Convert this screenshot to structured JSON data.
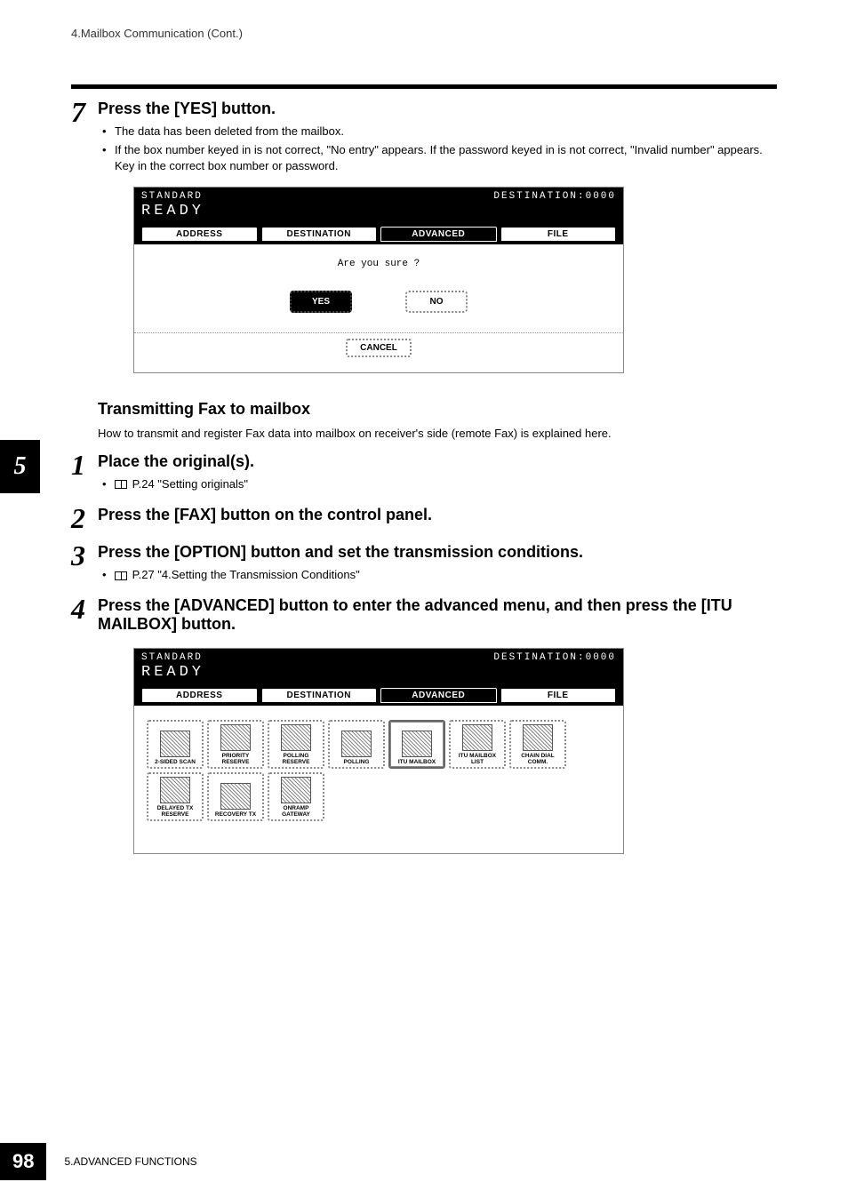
{
  "header": "4.Mailbox Communication (Cont.)",
  "chapter_tab": "5",
  "step7": {
    "num": "7",
    "title": "Press the [YES] button.",
    "bullets": [
      "The data has been deleted from the mailbox.",
      "If the box number keyed in is not correct, \"No entry\" appears. If the password keyed in is not correct, \"Invalid number\" appears. Key in the correct box number or password."
    ]
  },
  "screenshot1": {
    "top_left": "STANDARD",
    "ready": "READY",
    "top_right": "DESTINATION:0000",
    "tabs": [
      "ADDRESS",
      "DESTINATION",
      "ADVANCED",
      "FILE"
    ],
    "active_tab_index": 2,
    "prompt": "Are you sure ?",
    "yes": "YES",
    "no": "NO",
    "cancel": "CANCEL"
  },
  "section": {
    "heading": "Transmitting Fax to mailbox",
    "intro": "How to transmit and register Fax data into mailbox on receiver's side (remote Fax) is explained here."
  },
  "step1": {
    "num": "1",
    "title": "Place the original(s).",
    "ref": "P.24 \"Setting originals\""
  },
  "step2": {
    "num": "2",
    "title": "Press the [FAX] button on the control panel."
  },
  "step3": {
    "num": "3",
    "title": "Press the [OPTION] button and set the transmission conditions.",
    "ref": "P.27 \"4.Setting the Transmission Conditions\""
  },
  "step4": {
    "num": "4",
    "title": "Press the [ADVANCED] button to enter the advanced menu, and then press the [ITU MAILBOX] button."
  },
  "screenshot2": {
    "top_left": "STANDARD",
    "ready": "READY",
    "top_right": "DESTINATION:0000",
    "tabs": [
      "ADDRESS",
      "DESTINATION",
      "ADVANCED",
      "FILE"
    ],
    "active_tab_index": 2,
    "buttons_row1": [
      "2-SIDED SCAN",
      "PRIORITY RESERVE",
      "POLLING RESERVE",
      "POLLING",
      "ITU MAILBOX",
      "ITU MAILBOX LIST",
      "CHAIN DIAL COMM."
    ],
    "selected_row1": 4,
    "buttons_row2": [
      "DELAYED TX RESERVE",
      "RECOVERY TX",
      "ONRAMP GATEWAY"
    ]
  },
  "page_number": "98",
  "footer": "5.ADVANCED FUNCTIONS"
}
